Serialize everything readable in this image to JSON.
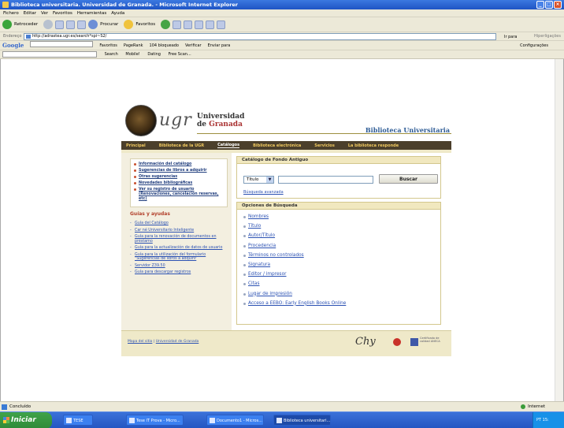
{
  "window": {
    "title": "Biblioteca universitaria. Universidad de Granada. - Microsoft Internet Explorer",
    "min": "_",
    "max": "□",
    "close": "×"
  },
  "menubar": [
    "Fichero",
    "Editar",
    "Ver",
    "Favoritos",
    "Herramientas",
    "Ayuda"
  ],
  "toolbar": {
    "back": "Retroceder",
    "search": "Procurar",
    "favorites": "Favoritos"
  },
  "address": {
    "label": "Endereço",
    "url": "http://adrastea.ugr.es/search*spi~S2/",
    "go": "Ir para",
    "links": "Hiperligações"
  },
  "googlebar": {
    "logo": "Google",
    "items": [
      "Favoritos",
      "PageRank",
      "104 bloqueado",
      "Verificar",
      "Enviar para"
    ],
    "settings": "Configurações"
  },
  "searchbar": {
    "items": [
      "Search",
      "Mobile!",
      "Dating",
      "Free Scan..."
    ]
  },
  "site": {
    "ugr": "ugr",
    "name_1": "Universidad",
    "name_de": "de",
    "name_2": "Granada",
    "biblio": "Biblioteca Universitaria",
    "nav": [
      "Principal",
      "Biblioteca de la UGR",
      "Catálogos",
      "Biblioteca electrónica",
      "Servicios",
      "La biblioteca responde"
    ],
    "left_links": [
      "Información del catálogo",
      "Sugerencias de libros a adquirir",
      "Otras sugerencias",
      "Novedades bibliográficas",
      "Ver su registro de usuario (Renovaciones, cancelación reservas, etc)"
    ],
    "guias_title": "Guías y ayudas",
    "guias": [
      "Guía del Catálogo",
      "Car né Universitario Inteligente",
      "Guía para la renovación de documentos en préstamo",
      "Guía para la actualización de datos de usuario",
      "Guía para la utilización del formulario \"Sugerencias de libros a adquirir",
      "Servidor Z39.50",
      "Guía para descargar registros"
    ],
    "fondo": {
      "title": "Catálogo de Fondo Antiguo",
      "select": "Título",
      "input": "",
      "button": "Buscar",
      "advanced": "Búsqueda avanzada"
    },
    "opciones": {
      "title": "Opciones de Búsqueda",
      "items": [
        "Nombres",
        "Título",
        "Autor/Título",
        "Procedencia",
        "Términos no controlados",
        "Signatura",
        "Editor / impresor",
        "Citas",
        "Lugar de impresión",
        "Acceso a EEBO: Early English Books Online"
      ]
    },
    "footer": {
      "mapa": "Mapa del sitio",
      "sep": "|",
      "univ": "Universidad de Granada",
      "logo": "Chy",
      "cert": "Certificado de calidad ANECA"
    }
  },
  "status": {
    "text": "Concluído",
    "zone": "Internet"
  },
  "taskbar": {
    "start": "Iniciar",
    "tasks": [
      "TESE",
      "Tese IT Prova - Micro...",
      "Documento1 - Micros...",
      "Biblioteca universitari..."
    ],
    "tray": "PT 15:"
  }
}
